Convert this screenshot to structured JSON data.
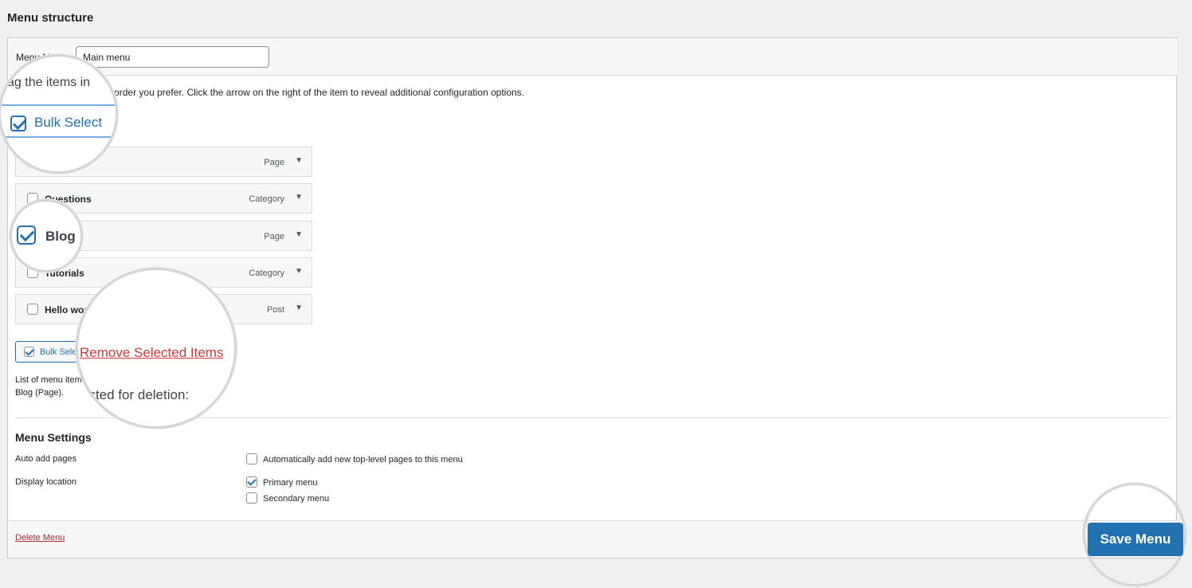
{
  "page": {
    "heading": "Menu structure"
  },
  "menu_name": {
    "label": "Menu Name",
    "value": "Main menu"
  },
  "instructions": "Drag the items into the order you prefer. Click the arrow on the right of the item to reveal additional configuration options.",
  "bulk_select_label": "Bulk Select",
  "items": [
    {
      "title": "",
      "type": "Page",
      "checked": false
    },
    {
      "title": "Questions",
      "type": "Category",
      "checked": false
    },
    {
      "title": "Blog",
      "type": "Page",
      "checked": true
    },
    {
      "title": "Tutorials",
      "type": "Category",
      "checked": false
    },
    {
      "title": "Hello world!",
      "type": "Post",
      "checked": false
    }
  ],
  "bulk_button_label": "Bulk Select",
  "remove_label": "Remove Selected Items",
  "list_desc": {
    "line1": "List of menu items selected for deletion:",
    "line2": "Blog (Page)."
  },
  "zoom": {
    "drag_text": "ag the items in",
    "selected_text": "ected for deletion:"
  },
  "settings": {
    "title": "Menu Settings",
    "auto_add_label": "Auto add pages",
    "auto_add_option": "Automatically add new top-level pages to this menu",
    "display_label": "Display location",
    "primary": "Primary menu",
    "secondary": "Secondary menu"
  },
  "footer": {
    "delete": "Delete Menu",
    "save": "Save Menu"
  },
  "colors": {
    "accent": "#2271b1",
    "danger": "#b32d2e",
    "bg": "#f0f0f1"
  }
}
